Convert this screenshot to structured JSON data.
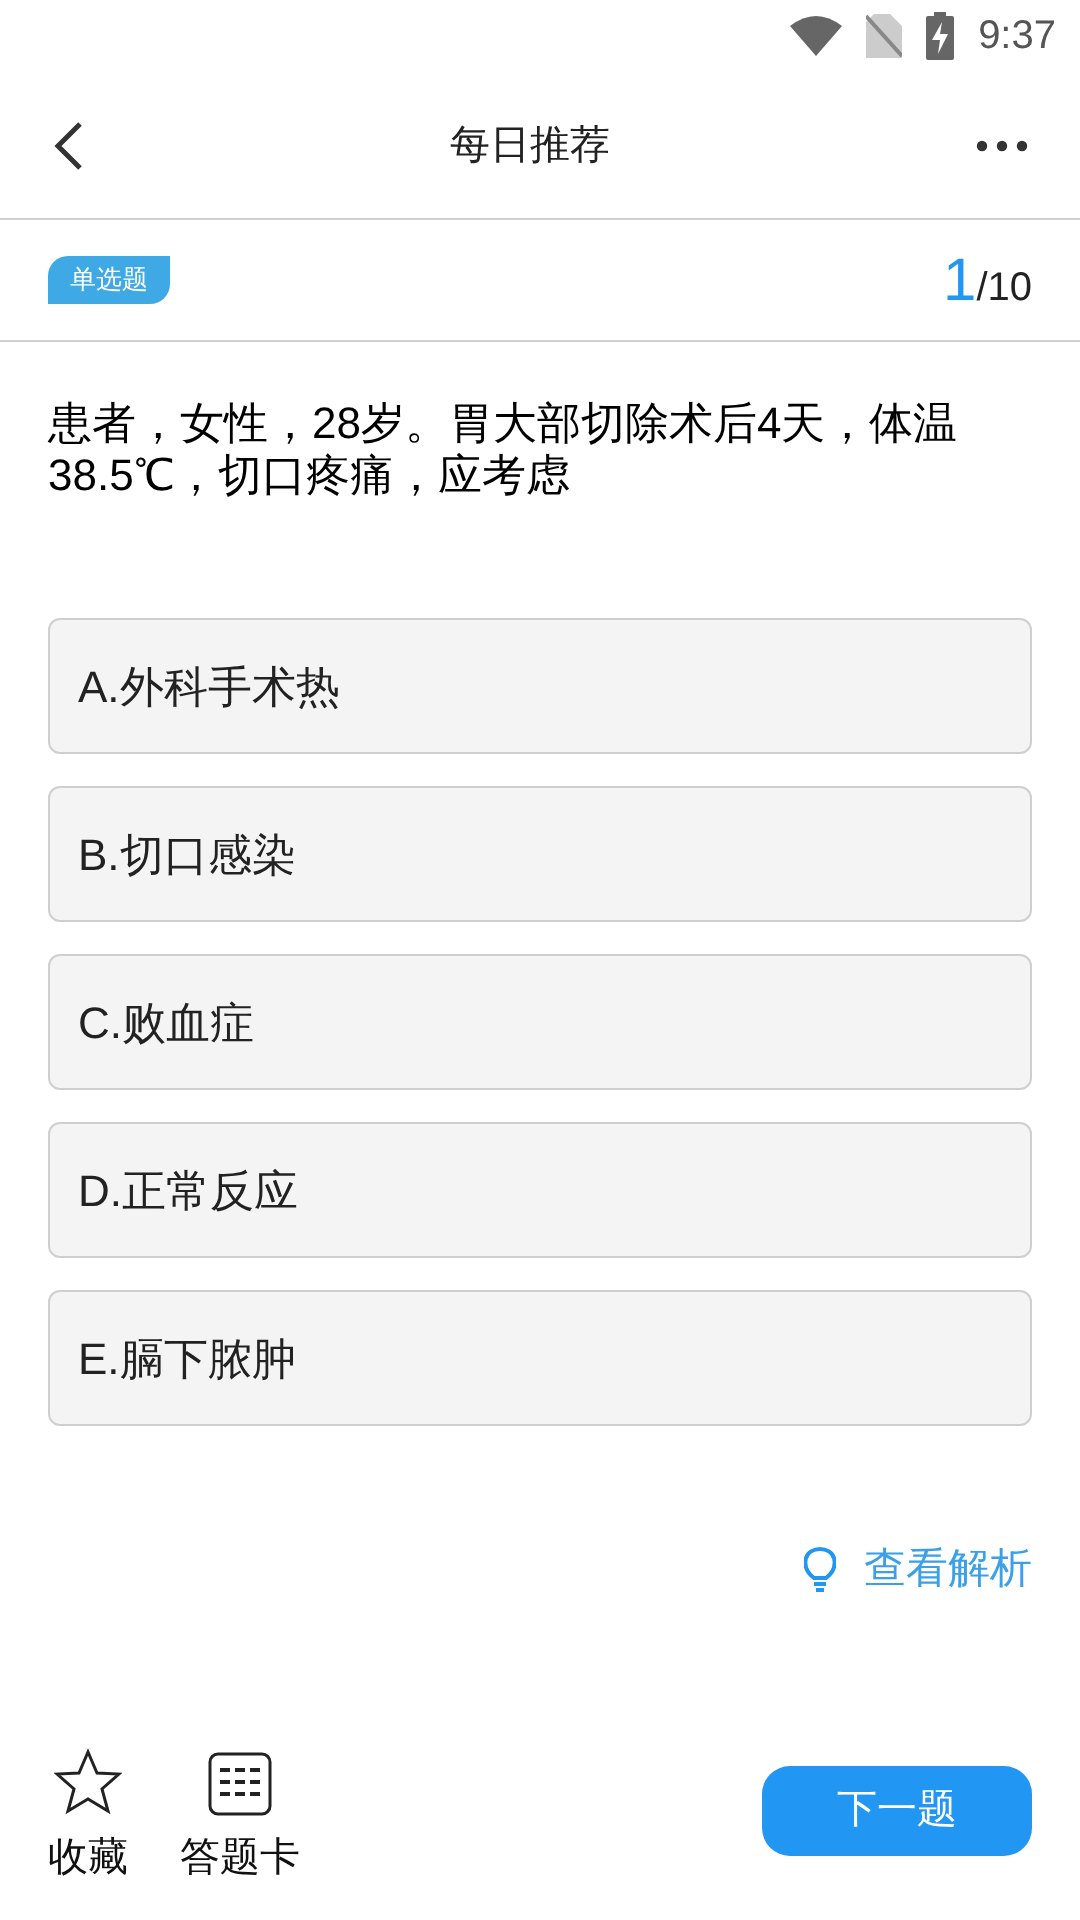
{
  "status_bar": {
    "time": "9:37"
  },
  "header": {
    "title": "每日推荐"
  },
  "question": {
    "type_badge": "单选题",
    "current": "1",
    "total": "/10",
    "text": "患者，女性，28岁。胃大部切除术后4天，体温38.5℃，切口疼痛，应考虑"
  },
  "options": [
    {
      "label": "A.外科手术热",
      "selected": false
    },
    {
      "label": "B.切口感染",
      "selected": false
    },
    {
      "label": "C.败血症",
      "selected": false
    },
    {
      "label": "D.正常反应",
      "selected": false
    },
    {
      "label": "E.膈下脓肿",
      "selected": false
    }
  ],
  "analysis_link": "查看解析",
  "bottom_bar": {
    "favorite": "收藏",
    "answer_card": "答题卡",
    "next_button": "下一题"
  }
}
